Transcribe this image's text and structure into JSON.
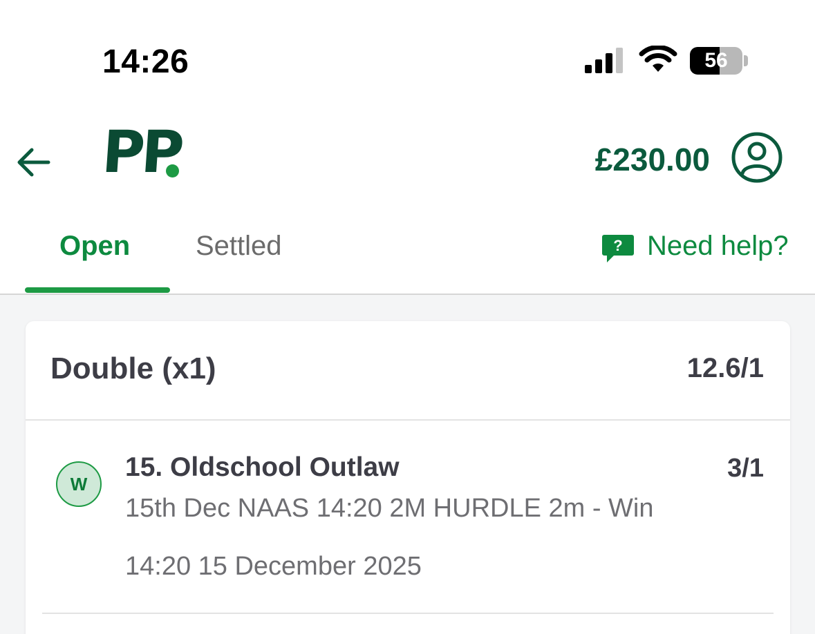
{
  "status_bar": {
    "time": "14:26",
    "battery_level": "56",
    "battery_fraction": 0.56,
    "icons": [
      "signal-icon",
      "wifi-icon",
      "battery-icon"
    ]
  },
  "header": {
    "back_icon": "back-arrow-icon",
    "logo_text": "PP",
    "balance": "£230.00",
    "account_icon": "account-icon"
  },
  "tabs": {
    "items": [
      {
        "label": "Open",
        "active": true
      },
      {
        "label": "Settled",
        "active": false
      }
    ],
    "help_label": "Need help?",
    "help_icon": "help-chat-icon"
  },
  "bet": {
    "type": "Double (x1)",
    "odds": "12.6/1",
    "legs": [
      {
        "status_badge": "W",
        "selection": "15. Oldschool Outlaw",
        "odds": "3/1",
        "event": "15th Dec NAAS 14:20 2M HURDLE 2m - Win",
        "start_time": "14:20 15 December 2025"
      }
    ]
  },
  "colors": {
    "brand_dark": "#0b4a33",
    "brand_green": "#1d9a44",
    "tab_active": "#0d8a3f",
    "text_primary": "#3d3d46",
    "text_secondary": "#6e6e72"
  }
}
